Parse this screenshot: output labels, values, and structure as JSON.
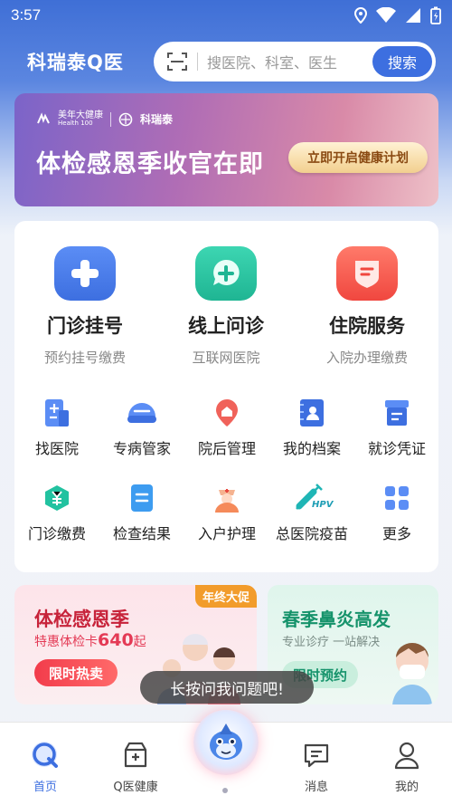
{
  "status_bar": {
    "time": "3:57"
  },
  "header": {
    "brand": "科瑞泰Q医",
    "search": {
      "placeholder": "搜医院、科室、医生",
      "button_label": "搜索"
    }
  },
  "banner": {
    "logo_1": "美年大健康",
    "logo_1_sub": "Health 100",
    "logo_2": "科瑞泰",
    "title": "体检感恩季收官在即",
    "cta_label": "立即开启健康计划"
  },
  "main_services": [
    {
      "label": "门诊挂号",
      "sub": "预约挂号缴费",
      "icon": "plus-icon",
      "color": "#4a7cf0"
    },
    {
      "label": "线上问诊",
      "sub": "互联网医院",
      "icon": "chat-plus-icon",
      "color": "#22c2a0"
    },
    {
      "label": "住院服务",
      "sub": "入院办理缴费",
      "icon": "hospital-bed-icon",
      "color": "#f5544d"
    }
  ],
  "grid_row_1": [
    {
      "label": "找医院",
      "icon": "hospital-doc-icon"
    },
    {
      "label": "专病管家",
      "icon": "helmet-icon"
    },
    {
      "label": "院后管理",
      "icon": "location-pin-icon"
    },
    {
      "label": "我的档案",
      "icon": "profile-book-icon"
    },
    {
      "label": "就诊凭证",
      "icon": "receipt-icon"
    }
  ],
  "grid_row_2": [
    {
      "label": "门诊缴费",
      "icon": "yuan-icon"
    },
    {
      "label": "检查结果",
      "icon": "report-icon"
    },
    {
      "label": "入户护理",
      "icon": "nurse-icon"
    },
    {
      "label": "总医院疫苗",
      "icon": "vaccine-icon",
      "badge": "HPV"
    },
    {
      "label": "更多",
      "icon": "grid-more-icon"
    }
  ],
  "promo_left": {
    "tag": "年终大促",
    "title": "体检感恩季",
    "sub_prefix": "特惠体检卡",
    "price": "640",
    "sub_suffix": "起",
    "button_label": "限时热卖"
  },
  "promo_right": {
    "title": "春季鼻炎高发",
    "sub": "专业诊疗 一站解决",
    "button_label": "限时预约"
  },
  "tooltip": "长按问我问题吧!",
  "tabbar": [
    {
      "label": "首页",
      "icon": "home-q-icon",
      "active": true
    },
    {
      "label": "Q医健康",
      "icon": "health-box-icon",
      "active": false
    },
    {
      "label": "消息",
      "icon": "message-icon",
      "active": false
    },
    {
      "label": "我的",
      "icon": "user-icon",
      "active": false
    }
  ],
  "colors": {
    "primary": "#3d6fe0",
    "red": "#f23c4b",
    "green": "#16936b",
    "orange": "#f29c2b"
  }
}
